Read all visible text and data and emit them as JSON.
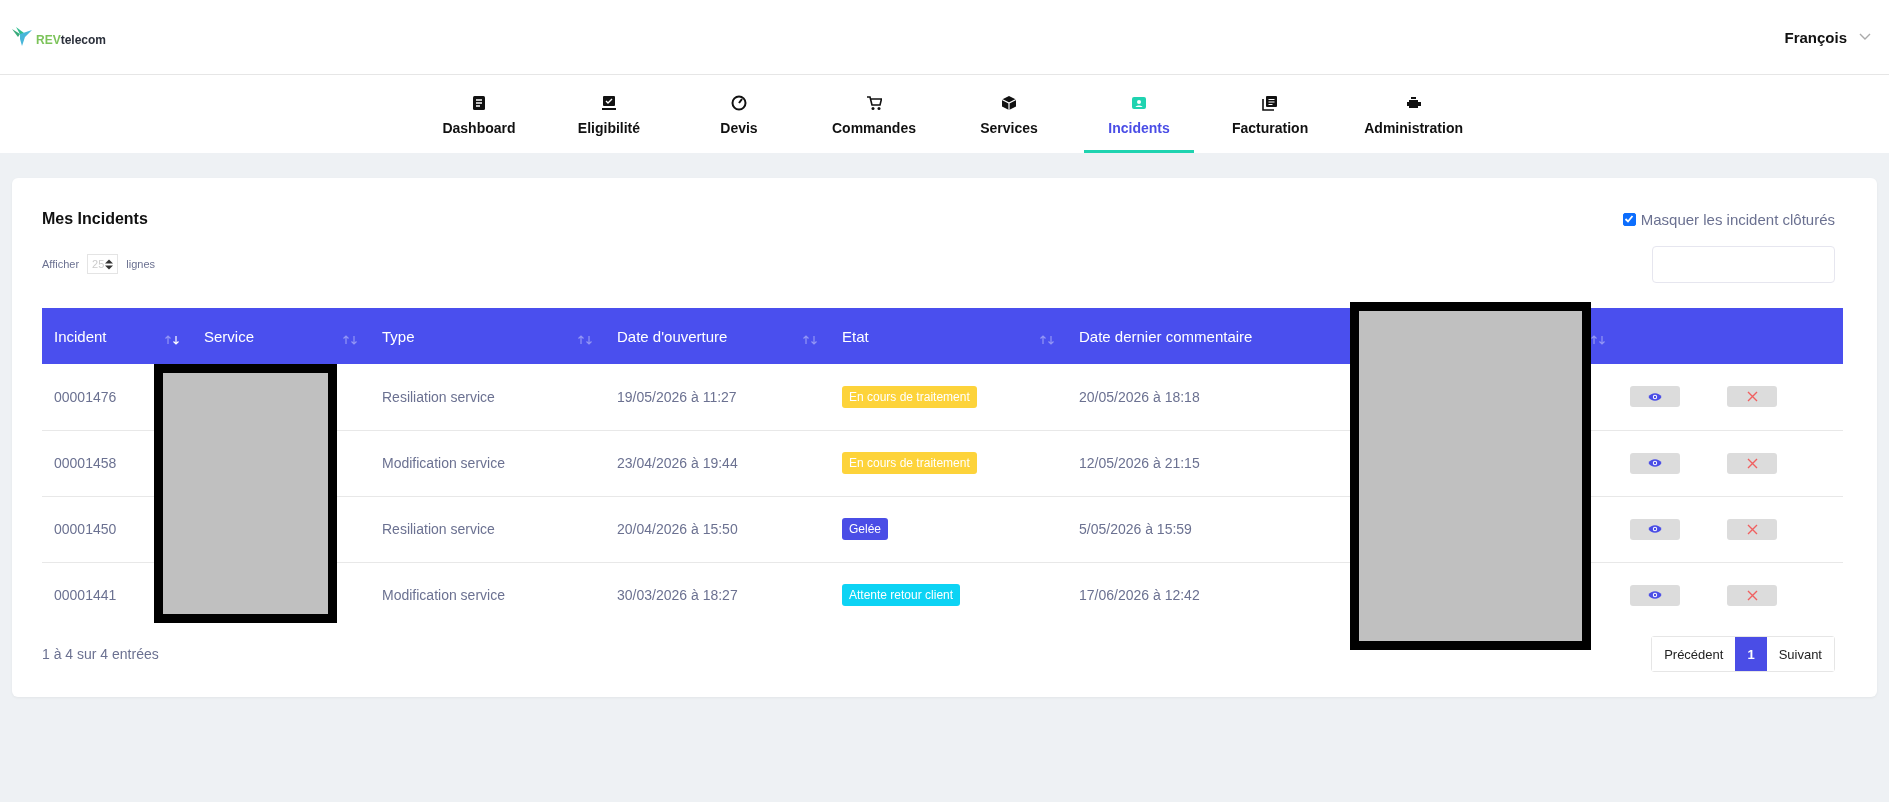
{
  "header": {
    "logo": {
      "prefix": "REV",
      "suffix": "telecom"
    },
    "user": "François"
  },
  "nav": [
    {
      "label": "Dashboard",
      "selected": false
    },
    {
      "label": "Eligibilité",
      "selected": false
    },
    {
      "label": "Devis",
      "selected": false
    },
    {
      "label": "Commandes",
      "selected": false
    },
    {
      "label": "Services",
      "selected": false
    },
    {
      "label": "Incidents",
      "selected": true
    },
    {
      "label": "Facturation",
      "selected": false
    },
    {
      "label": "Administration",
      "selected": false
    }
  ],
  "card": {
    "title": "Mes Incidents",
    "hide_closed": {
      "label": "Masquer les incident clôturés",
      "checked": true
    },
    "length": {
      "before": "Afficher",
      "value": "25",
      "after": "lignes"
    },
    "table": {
      "columns": [
        {
          "label": "Incident",
          "sorted": true
        },
        {
          "label": "Service",
          "sorted": false
        },
        {
          "label": "Type",
          "sorted": false
        },
        {
          "label": "Date d'ouverture",
          "sorted": false
        },
        {
          "label": "Etat",
          "sorted": false
        },
        {
          "label": "Date dernier commentaire"
        },
        {
          "sorted": false
        },
        {},
        {}
      ],
      "rows": [
        {
          "incident": "00001476",
          "type": "Resiliation service",
          "opened": "19/05/2026 à 11:27",
          "status": {
            "label": "En cours de traitement",
            "color": "#fdd33a"
          },
          "last_comment": "20/05/2026 à 18:18"
        },
        {
          "incident": "00001458",
          "type": "Modification service",
          "opened": "23/04/2026 à 19:44",
          "status": {
            "label": "En cours de traitement",
            "color": "#fdd33a"
          },
          "last_comment": "12/05/2026 à 21:15"
        },
        {
          "incident": "00001450",
          "type": "Resiliation service",
          "opened": "20/04/2026 à 15:50",
          "status": {
            "label": "Gelée",
            "color": "#4a4de6"
          },
          "last_comment": "5/05/2026 à 15:59"
        },
        {
          "incident": "00001441",
          "type": "Modification service",
          "opened": "30/03/2026 à 18:27",
          "status": {
            "label": "Attente retour client",
            "color": "#0dd3f4"
          },
          "last_comment": "17/06/2026 à 12:42"
        }
      ]
    },
    "info": "1 à 4 sur 4 entrées",
    "pagination": [
      {
        "label": "Précédent",
        "selected": false
      },
      {
        "label": "1",
        "selected": true
      },
      {
        "label": "Suivant",
        "selected": false
      }
    ]
  },
  "redactions": [
    {
      "kind": "block"
    },
    {
      "kind": "block"
    }
  ]
}
